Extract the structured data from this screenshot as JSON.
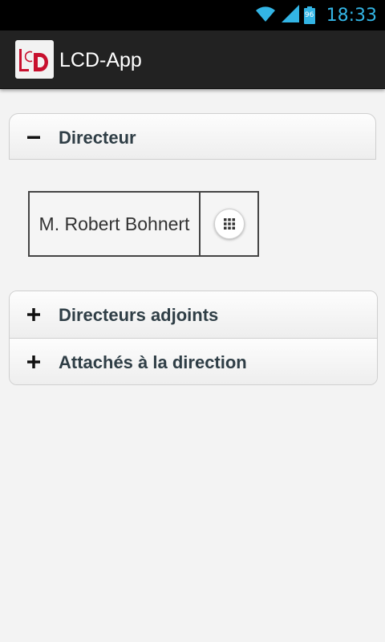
{
  "status_bar": {
    "time": "18:33",
    "battery_level": "96",
    "icons": [
      "wifi-icon",
      "signal-icon",
      "battery-icon"
    ],
    "accent_color": "#33b5e5"
  },
  "action_bar": {
    "title": "LCD-App",
    "logo": "lcd-logo-icon",
    "logo_letters": "LCD",
    "logo_color": "#c8102e"
  },
  "accordion": {
    "sections": [
      {
        "label": "Directeur",
        "expanded": true,
        "people": [
          {
            "name": "M. Robert Bohnert",
            "action_icon": "grid-icon"
          }
        ]
      },
      {
        "label": "Directeurs adjoints",
        "expanded": false
      },
      {
        "label": "Attachés à la direction",
        "expanded": false
      }
    ]
  }
}
